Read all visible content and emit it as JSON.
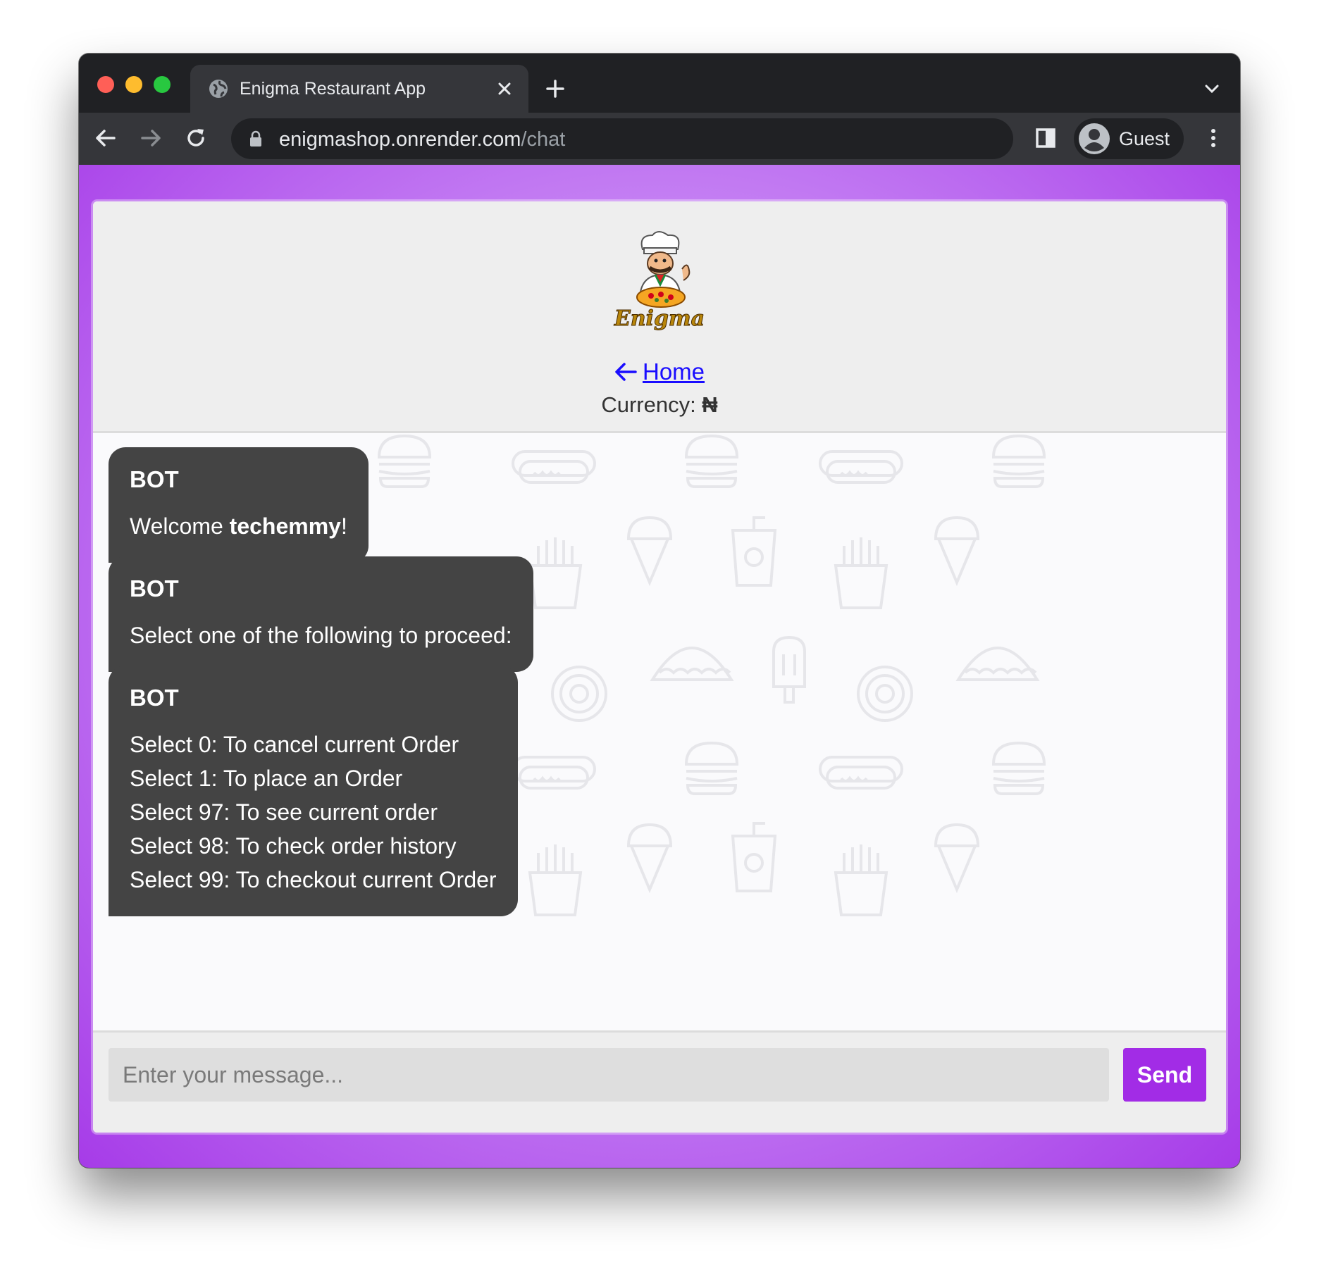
{
  "browser": {
    "tab_title": "Enigma Restaurant App",
    "url_host": "enigmashop.onrender.com",
    "url_path": "/chat",
    "profile_label": "Guest"
  },
  "header": {
    "logo_text": "Enigma",
    "home_link": "Home",
    "currency_label": "Currency: ",
    "currency_symbol": "₦"
  },
  "messages": [
    {
      "sender": "BOT",
      "lines": [
        {
          "pre": "Welcome ",
          "bold": "techemmy",
          "post": "!"
        }
      ]
    },
    {
      "sender": "BOT",
      "lines": [
        {
          "text": "Select one of the following to proceed:"
        }
      ]
    },
    {
      "sender": "BOT",
      "lines": [
        {
          "text": "Select 0: To cancel current Order"
        },
        {
          "text": "Select 1: To place an Order"
        },
        {
          "text": "Select 97: To see current order"
        },
        {
          "text": "Select 98: To check order history"
        },
        {
          "text": "Select 99: To checkout current Order"
        }
      ]
    }
  ],
  "composer": {
    "placeholder": "Enter your message...",
    "value": "",
    "send_label": "Send"
  },
  "colors": {
    "accent": "#a22ce6",
    "bubble": "#444444",
    "link": "#1a0dff"
  },
  "icons": [
    "globe-icon",
    "close-icon",
    "plus-icon",
    "chevron-down-icon",
    "back-arrow-icon",
    "forward-arrow-icon",
    "reload-icon",
    "lock-icon",
    "side-panel-icon",
    "avatar-icon",
    "kebab-menu-icon",
    "left-arrow-icon"
  ]
}
